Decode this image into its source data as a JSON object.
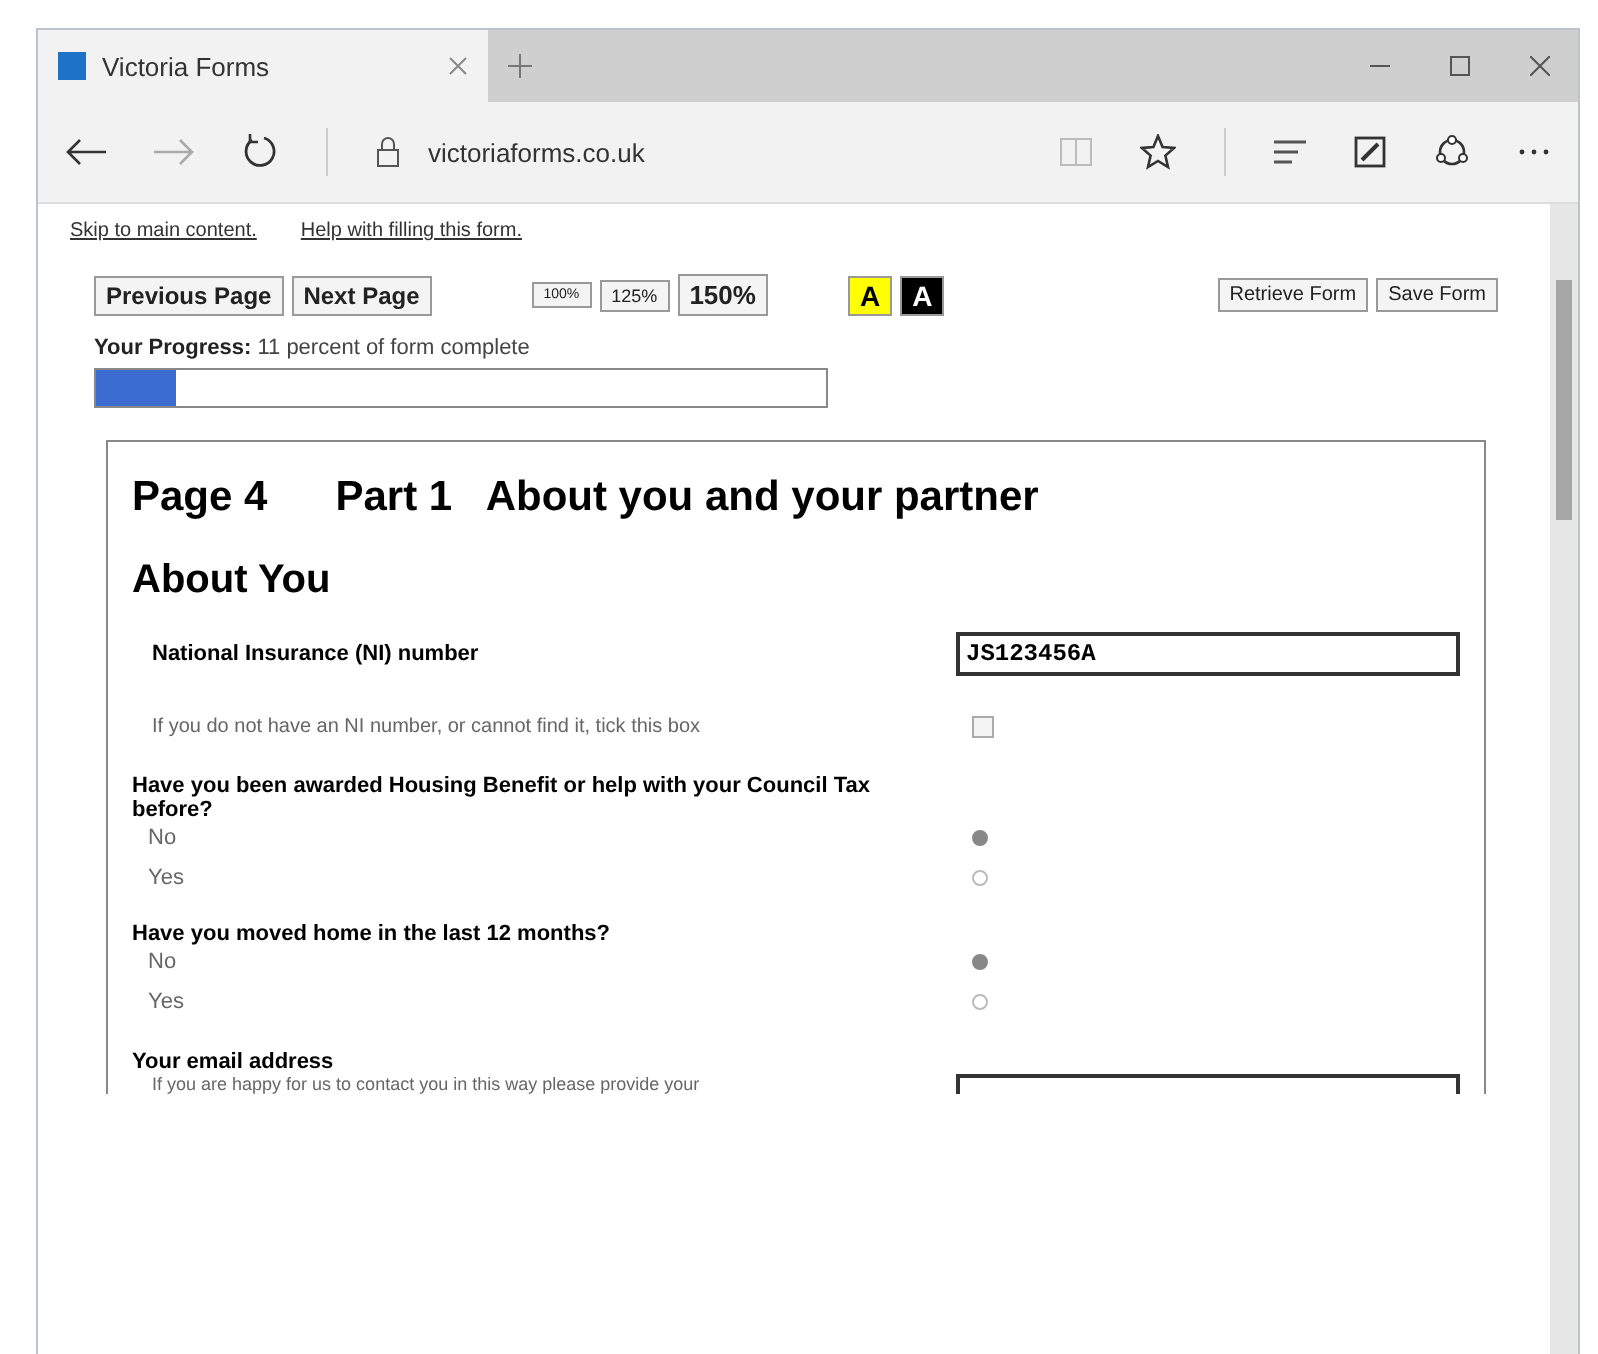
{
  "browser": {
    "tab_title": "Victoria Forms",
    "address": "victoriaforms.co.uk"
  },
  "links": [
    "Skip to main content.",
    "Help with filling this form."
  ],
  "nav_buttons": [
    "Previous Page",
    "Next Page"
  ],
  "zoom_buttons": [
    "100%",
    "125%",
    "150%"
  ],
  "contrast_buttons": [
    {
      "label": "A",
      "kind": "yellow"
    },
    {
      "label": "A",
      "kind": "black"
    }
  ],
  "form_buttons": [
    "Retrieve Form",
    "Save Form"
  ],
  "progress": {
    "label": "Your Progress:",
    "text": "11 percent of form complete",
    "level": 0.11
  },
  "page_heading": {
    "page": "Page 4",
    "part": "Part 1",
    "title": "About you and your partner"
  },
  "section_heading": "About You",
  "ni": {
    "label": "National Insurance (NI) number",
    "value": "JS123456A",
    "checkbox_label": "If you do not have an NI number, or cannot find it, tick this box",
    "checked": false
  },
  "questions": [
    {
      "label": "Have you been awarded Housing Benefit or help with your Council Tax before?",
      "options": [
        {
          "label": "No",
          "selected": true
        },
        {
          "label": "Yes",
          "selected": false
        }
      ]
    },
    {
      "label": "Have you moved home in the last 12 months?",
      "options": [
        {
          "label": "No",
          "selected": true
        },
        {
          "label": "Yes",
          "selected": false
        }
      ]
    }
  ],
  "email": {
    "label": "Your email address",
    "hint": "If you are happy for us to contact you in this way please provide your"
  }
}
